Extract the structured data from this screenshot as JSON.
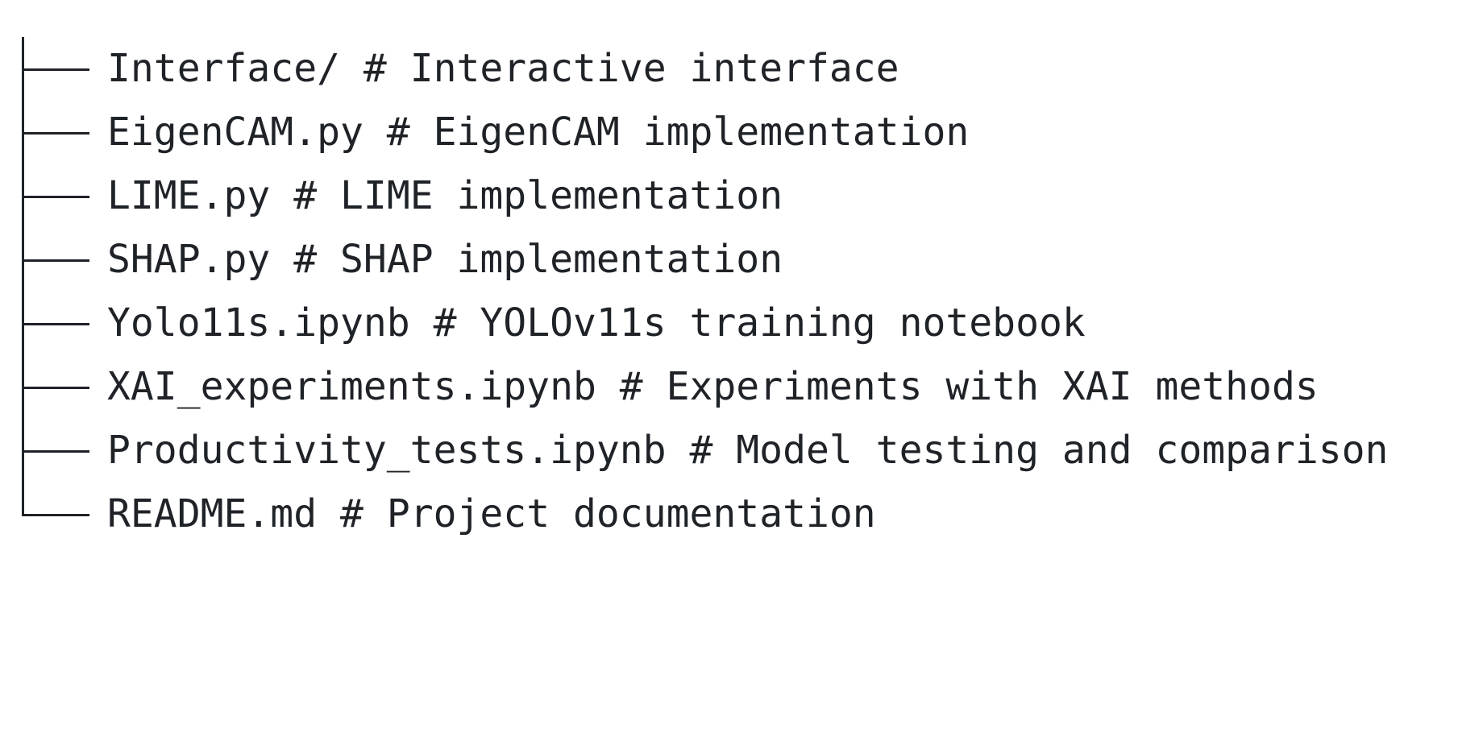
{
  "tree": {
    "items": [
      {
        "name": "Interface/",
        "marker": "#",
        "comment": "Interactive interface",
        "last": false
      },
      {
        "name": "EigenCAM.py",
        "marker": "#",
        "comment": "EigenCAM implementation",
        "last": false
      },
      {
        "name": "LIME.py",
        "marker": "#",
        "comment": "LIME implementation",
        "last": false
      },
      {
        "name": "SHAP.py",
        "marker": "#",
        "comment": "SHAP implementation",
        "last": false
      },
      {
        "name": "Yolo11s.ipynb",
        "marker": "#",
        "comment": "YOLOv11s training notebook",
        "last": false
      },
      {
        "name": "XAI_experiments.ipynb",
        "marker": "#",
        "comment": "Experiments with XAI methods",
        "last": false
      },
      {
        "name": "Productivity_tests.ipynb",
        "marker": "#",
        "comment": "Model testing and comparison",
        "last": false
      },
      {
        "name": "README.md",
        "marker": "#",
        "comment": "Project documentation",
        "last": true
      }
    ]
  }
}
